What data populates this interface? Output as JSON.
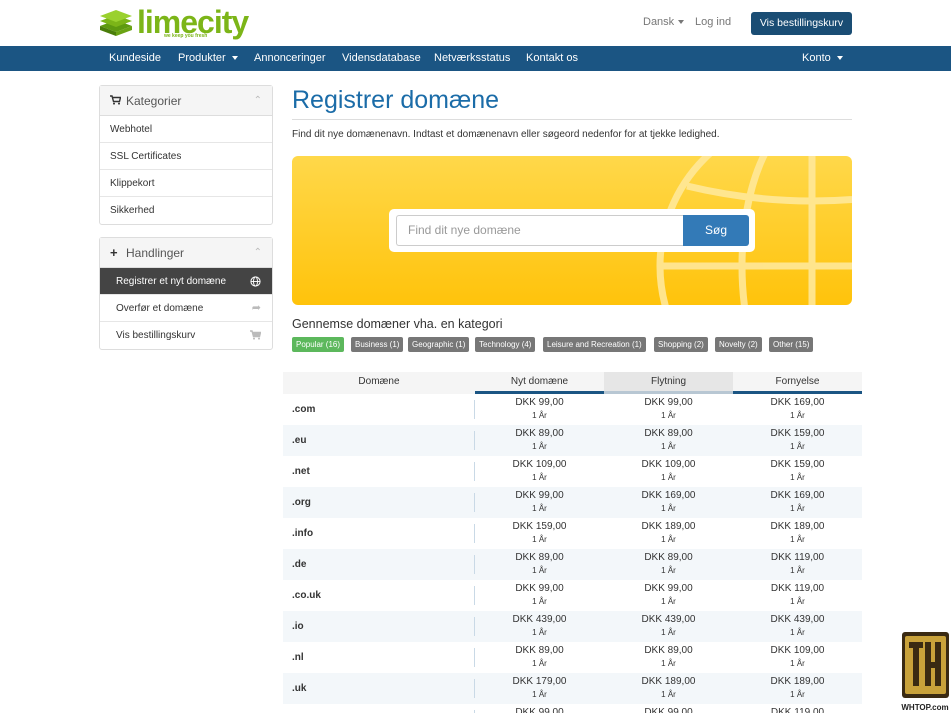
{
  "brand": {
    "name": "limecity",
    "tagline": "we keep you fresh",
    "color": "#7cb518"
  },
  "header": {
    "language": "Dansk",
    "login": "Log ind",
    "cart_button": "Vis bestillingskurv"
  },
  "nav": {
    "items": [
      {
        "label": "Kundeside"
      },
      {
        "label": "Produkter"
      },
      {
        "label": "Annonceringer"
      },
      {
        "label": "Vidensdatabase"
      },
      {
        "label": "Netværksstatus"
      },
      {
        "label": "Kontakt os"
      }
    ],
    "account": "Konto",
    "color": "#1b5583"
  },
  "sidebar": {
    "categories": {
      "title": "Kategorier",
      "icon": "cart-icon",
      "items": [
        {
          "label": "Webhotel"
        },
        {
          "label": "SSL Certificates"
        },
        {
          "label": "Klippekort"
        },
        {
          "label": "Sikkerhed"
        }
      ]
    },
    "actions": {
      "title": "Handlinger",
      "icon": "plus-icon",
      "items": [
        {
          "label": "Registrer et nyt domæne",
          "icon": "globe-icon",
          "active": true
        },
        {
          "label": "Overfør et domæne",
          "icon": "share-icon"
        },
        {
          "label": "Vis bestillingskurv",
          "icon": "cart-icon"
        }
      ]
    }
  },
  "main": {
    "title": "Registrer domæne",
    "intro": "Find dit nye domænenavn. Indtast et domænenavn eller søgeord nedenfor for at tjekke ledighed.",
    "search": {
      "placeholder": "Find dit nye domæne",
      "button": "Søg"
    },
    "browse_title": "Gennemse domæner vha. en kategori",
    "categories": [
      {
        "label": "Popular (16)",
        "active": true
      },
      {
        "label": "Business (1)"
      },
      {
        "label": "Geographic (1)"
      },
      {
        "label": "Technology (4)"
      },
      {
        "label": "Leisure and Recreation (1)"
      },
      {
        "label": "Shopping (2)"
      },
      {
        "label": "Novelty (2)"
      },
      {
        "label": "Other (15)"
      }
    ],
    "table": {
      "headers": {
        "domain": "Domæne",
        "new": "Nyt domæne",
        "transfer": "Flytning",
        "renew": "Fornyelse"
      },
      "period": "1 År",
      "rows": [
        {
          "tld": ".com",
          "new": "DKK 99,00",
          "transfer": "DKK 99,00",
          "renew": "DKK 169,00"
        },
        {
          "tld": ".eu",
          "new": "DKK 89,00",
          "transfer": "DKK 89,00",
          "renew": "DKK 159,00"
        },
        {
          "tld": ".net",
          "new": "DKK 109,00",
          "transfer": "DKK 109,00",
          "renew": "DKK 159,00"
        },
        {
          "tld": ".org",
          "new": "DKK 99,00",
          "transfer": "DKK 169,00",
          "renew": "DKK 169,00"
        },
        {
          "tld": ".info",
          "new": "DKK 159,00",
          "transfer": "DKK 189,00",
          "renew": "DKK 189,00"
        },
        {
          "tld": ".de",
          "new": "DKK 89,00",
          "transfer": "DKK 89,00",
          "renew": "DKK 119,00"
        },
        {
          "tld": ".co.uk",
          "new": "DKK 99,00",
          "transfer": "DKK 99,00",
          "renew": "DKK 119,00"
        },
        {
          "tld": ".io",
          "new": "DKK 439,00",
          "transfer": "DKK 439,00",
          "renew": "DKK 439,00"
        },
        {
          "tld": ".nl",
          "new": "DKK 89,00",
          "transfer": "DKK 89,00",
          "renew": "DKK 109,00"
        },
        {
          "tld": ".uk",
          "new": "DKK 179,00",
          "transfer": "DKK 189,00",
          "renew": "DKK 189,00"
        },
        {
          "tld": "",
          "new": "DKK 99,00",
          "transfer": "DKK 99,00",
          "renew": "DKK 119,00"
        }
      ]
    }
  },
  "watermark": {
    "text": "WHTOP.com"
  }
}
